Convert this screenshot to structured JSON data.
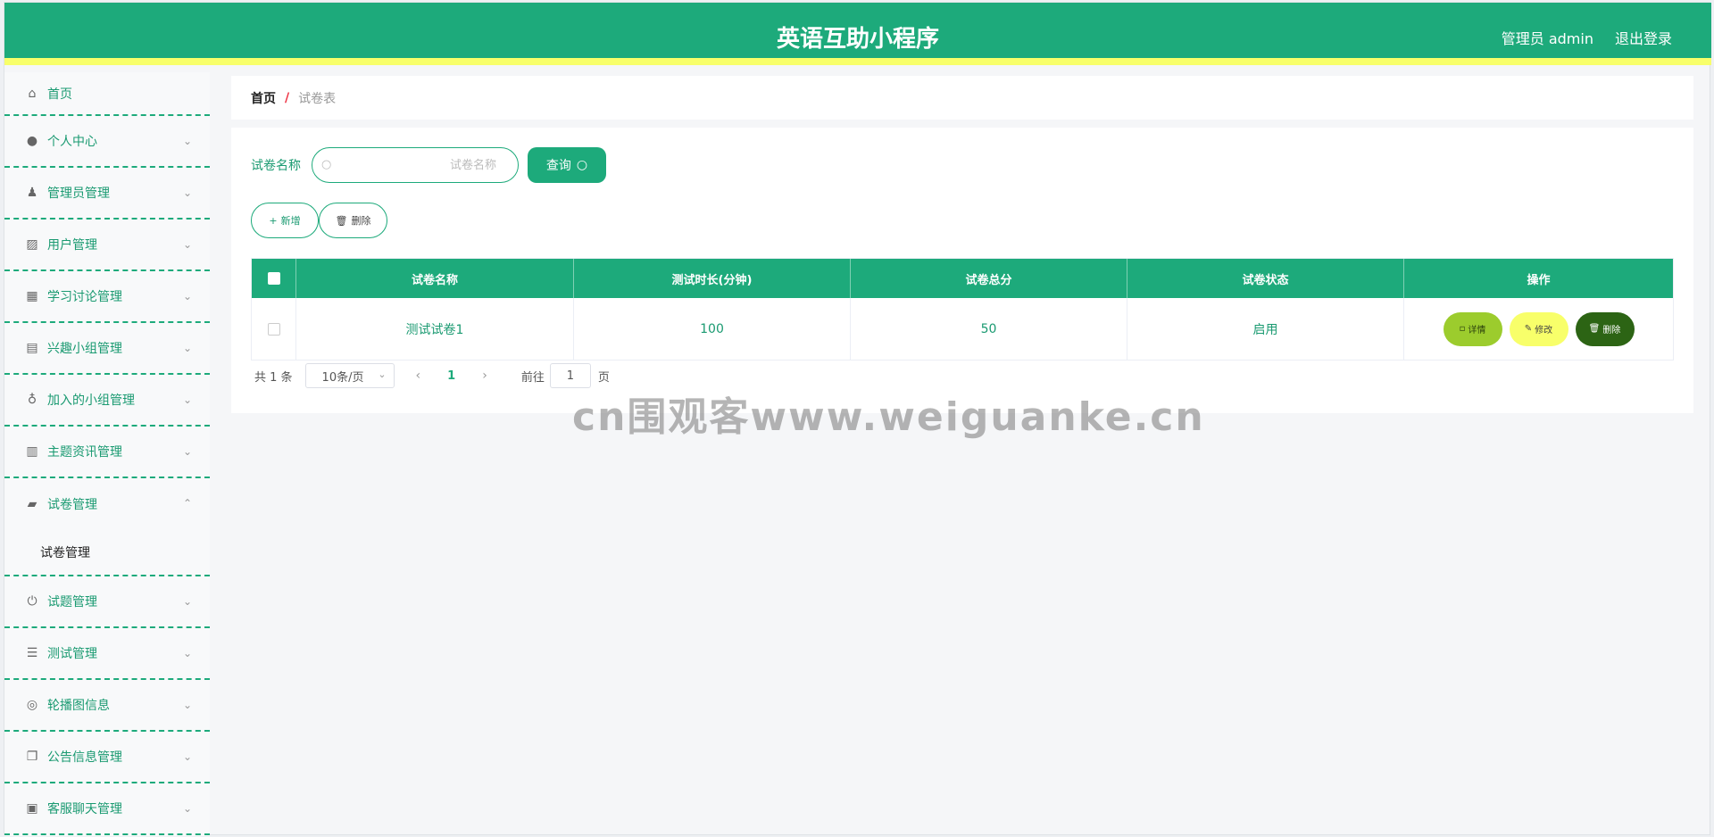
{
  "header": {
    "title": "英语互助小程序",
    "admin_label": "管理员 admin",
    "logout_label": "退出登录"
  },
  "sidebar": {
    "items": [
      {
        "label": "首页",
        "icon": "home-icon"
      },
      {
        "label": "个人中心",
        "icon": "user-icon"
      },
      {
        "label": "管理员管理",
        "icon": "admin-icon"
      },
      {
        "label": "用户管理",
        "icon": "chart-icon"
      },
      {
        "label": "学习讨论管理",
        "icon": "grid-icon"
      },
      {
        "label": "兴趣小组管理",
        "icon": "briefcase-icon"
      },
      {
        "label": "加入的小组管理",
        "icon": "balloon-icon"
      },
      {
        "label": "主题资讯管理",
        "icon": "bar-chart-icon"
      },
      {
        "label": "试卷管理",
        "icon": "tag-icon"
      },
      {
        "label": "试题管理",
        "icon": "power-icon"
      },
      {
        "label": "测试管理",
        "icon": "list-icon"
      },
      {
        "label": "轮播图信息",
        "icon": "aperture-icon"
      },
      {
        "label": "公告信息管理",
        "icon": "copy-icon"
      },
      {
        "label": "客服聊天管理",
        "icon": "clipboard-icon"
      }
    ],
    "submenu_label": "试卷管理"
  },
  "breadcrumb": {
    "home": "首页",
    "separator": "/",
    "current": "试卷表"
  },
  "search": {
    "label": "试卷名称",
    "placeholder": "试卷名称",
    "query_label": "查询"
  },
  "actions": {
    "add_label": "新增",
    "delete_label": "删除"
  },
  "table": {
    "headers": [
      "试卷名称",
      "测试时长(分钟)",
      "试卷总分",
      "试卷状态",
      "操作"
    ],
    "rows": [
      {
        "name": "测试试卷1",
        "duration": "100",
        "score": "50",
        "status": "启用"
      }
    ],
    "op_labels": {
      "detail": "详情",
      "edit": "修改",
      "delete": "删除"
    }
  },
  "pagination": {
    "total": "共 1 条",
    "page_size": "10条/页",
    "current_page": "1",
    "goto_label": "前往",
    "goto_value": "1",
    "page_suffix": "页"
  },
  "watermark": "cn围观客www.weiguanke.cn",
  "colors": {
    "primary": "#1daa7b",
    "accent_yellow": "#f8ff6a",
    "detail": "#9ccc2d",
    "delete": "#2c6414"
  }
}
